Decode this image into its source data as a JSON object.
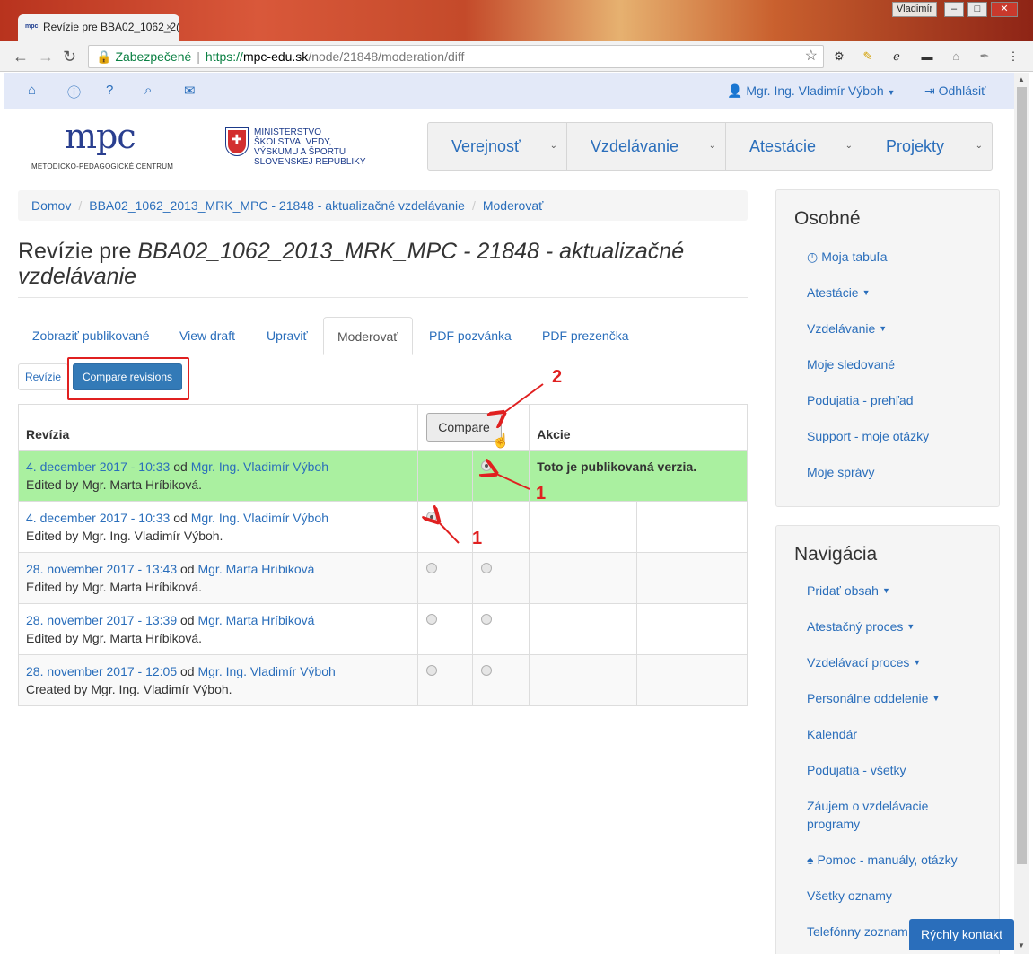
{
  "browser": {
    "tab_title": "Revízie pre BBA02_1062_2(",
    "tab_favicon": "mpc",
    "tab_close": "×",
    "window_user": "Vladimír",
    "win_minimize": "–",
    "win_maximize": "□",
    "win_close": "✕",
    "secure_label": "Zabezpečené",
    "url_scheme": "https://",
    "url_host": "mpc-edu.sk",
    "url_path": "/node/21848/moderation/diff"
  },
  "topnav": {
    "user_label": "Mgr. Ing. Vladimír Výboh",
    "logout_label": "Odhlásiť"
  },
  "header": {
    "mpc_logo": "mpc",
    "mpc_sub": "METODICKO-PEDAGOGICKÉ CENTRUM",
    "ministry_line1": "MINISTERSTVO",
    "ministry_line2": "ŠKOLSTVA, VEDY,",
    "ministry_line3": "VÝSKUMU A ŠPORTU",
    "ministry_line4": "SLOVENSKEJ REPUBLIKY",
    "menu": [
      "Verejnosť",
      "Vzdelávanie",
      "Atestácie",
      "Projekty"
    ]
  },
  "breadcrumb": [
    "Domov",
    "BBA02_1062_2013_MRK_MPC - 21848 - aktualizačné vzdelávanie",
    "Moderovať"
  ],
  "page": {
    "title_prefix": "Revízie pre ",
    "title_italic": "BBA02_1062_2013_MRK_MPC - 21848 - aktualizačné vzdelávanie"
  },
  "tabs": [
    "Zobraziť publikované",
    "View draft",
    "Upraviť",
    "Moderovať",
    "PDF pozvánka",
    "PDF prezenčka"
  ],
  "subtabs": {
    "revizie": "Revízie",
    "compare": "Compare revisions"
  },
  "table": {
    "header_revision": "Revízia",
    "compare_button": "Compare",
    "header_actions": "Akcie",
    "rows": [
      {
        "date": "4. december 2017 - 10:33",
        "od": "od",
        "author": "Mgr. Ing. Vladimír Výboh",
        "note": "Edited by Mgr. Marta Hríbiková.",
        "action": "Toto je publikovaná verzia."
      },
      {
        "date": "4. december 2017 - 10:33",
        "od": "od",
        "author": "Mgr. Ing. Vladimír Výboh",
        "note": "Edited by Mgr. Ing. Vladimír Výboh.",
        "action": ""
      },
      {
        "date": "28. november 2017 - 13:43",
        "od": "od",
        "author": "Mgr. Marta Hríbiková",
        "note": "Edited by Mgr. Marta Hríbiková.",
        "action": ""
      },
      {
        "date": "28. november 2017 - 13:39",
        "od": "od",
        "author": "Mgr. Marta Hríbiková",
        "note": "Edited by Mgr. Marta Hríbiková.",
        "action": ""
      },
      {
        "date": "28. november 2017 - 12:05",
        "od": "od",
        "author": "Mgr. Ing. Vladimír Výboh",
        "note": "Created by Mgr. Ing. Vladimír Výboh.",
        "action": ""
      }
    ]
  },
  "annotations": {
    "n1": "1",
    "n2": "2"
  },
  "sidebar": {
    "osobne_title": "Osobné",
    "osobne_items": [
      "Moja tabuľa",
      "Atestácie",
      "Vzdelávanie",
      "Moje sledované",
      "Podujatia - prehľad",
      "Support - moje otázky",
      "Moje správy"
    ],
    "navigacia_title": "Navigácia",
    "navigacia_items": [
      "Pridať obsah",
      "Atestačný proces",
      "Vzdelávací proces",
      "Personálne oddelenie",
      "Kalendár",
      "Podujatia - všetky",
      "Záujem o vzdelávacie programy",
      "Pomoc - manuály, otázky",
      "Všetky oznamy",
      "Telefónny zoznam"
    ]
  },
  "quick_contact": "Rýchly kontakt",
  "colors": {
    "accent": "#2a6ebb",
    "highlight_row": "#aaf0a0",
    "annotation": "#e02020",
    "primary_button": "#337ab7"
  }
}
